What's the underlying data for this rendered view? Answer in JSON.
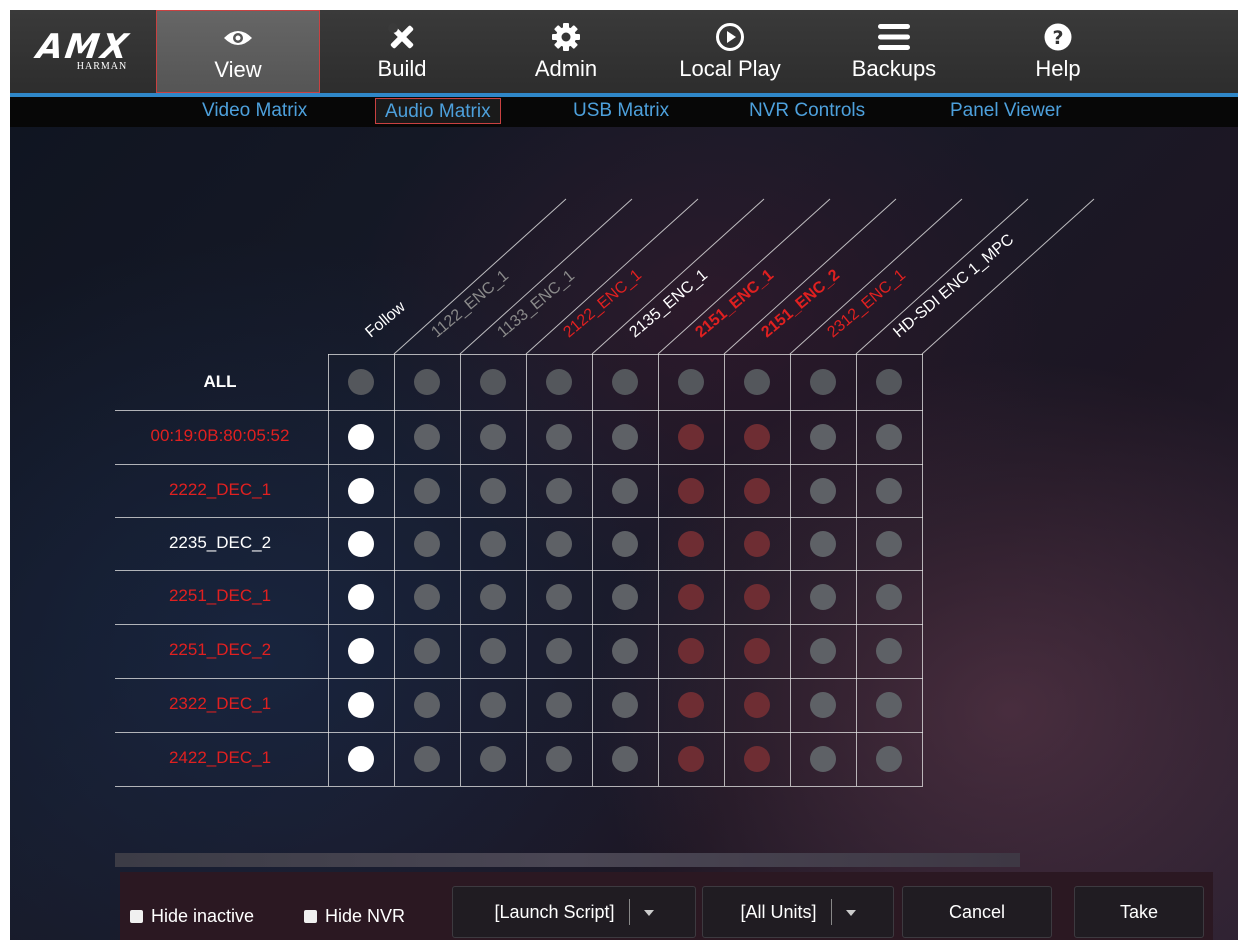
{
  "brand": {
    "logo": "AMX",
    "sub": "HARMAN"
  },
  "nav": [
    {
      "label": "View",
      "icon": "eye-icon",
      "active": true
    },
    {
      "label": "Build",
      "icon": "tools-icon",
      "active": false
    },
    {
      "label": "Admin",
      "icon": "gear-icon",
      "active": false
    },
    {
      "label": "Local Play",
      "icon": "play-icon",
      "active": false
    },
    {
      "label": "Backups",
      "icon": "menu-icon",
      "active": false
    },
    {
      "label": "Help",
      "icon": "help-icon",
      "active": false
    }
  ],
  "subnav": [
    {
      "label": "Video Matrix",
      "active": false
    },
    {
      "label": "Audio Matrix",
      "active": true
    },
    {
      "label": "USB Matrix",
      "active": false
    },
    {
      "label": "NVR Controls",
      "active": false
    },
    {
      "label": "Panel Viewer",
      "active": false
    }
  ],
  "matrix": {
    "columns": [
      {
        "label": "Follow",
        "color": "#ffffff",
        "bold": false
      },
      {
        "label": "1122_ENC_1",
        "color": "#8a8a8a",
        "bold": false
      },
      {
        "label": "1133_ENC_1",
        "color": "#8a8a8a",
        "bold": false
      },
      {
        "label": "2122_ENC_1",
        "color": "#e02020",
        "bold": false
      },
      {
        "label": "2135_ENC_1",
        "color": "#ffffff",
        "bold": false
      },
      {
        "label": "2151_ENC_1",
        "color": "#e02020",
        "bold": true
      },
      {
        "label": "2151_ENC_2",
        "color": "#e02020",
        "bold": true
      },
      {
        "label": "2312_ENC_1",
        "color": "#e02020",
        "bold": false
      },
      {
        "label": "HD-SDI ENC 1_MPC",
        "color": "#ffffff",
        "bold": false
      }
    ],
    "all_label": "ALL",
    "rows": [
      {
        "label": "00:19:0B:80:05:52",
        "color": "#e02020"
      },
      {
        "label": "2222_DEC_1",
        "color": "#e02020"
      },
      {
        "label": "2235_DEC_2",
        "color": "#ffffff"
      },
      {
        "label": "2251_DEC_1",
        "color": "#e02020"
      },
      {
        "label": "2251_DEC_2",
        "color": "#e02020"
      },
      {
        "label": "2322_DEC_1",
        "color": "#e02020"
      },
      {
        "label": "2422_DEC_1",
        "color": "#e02020"
      }
    ],
    "selected_column": "Follow",
    "red_columns": [
      "2151_ENC_1",
      "2151_ENC_2"
    ]
  },
  "footer": {
    "hide_inactive": "Hide inactive",
    "hide_nvr": "Hide NVR",
    "launch_script": "[Launch Script]",
    "all_units": "[All Units]",
    "cancel": "Cancel",
    "take": "Take"
  },
  "colors": {
    "accent": "#2f87c8",
    "link": "#4da0dc",
    "active_border": "#c94141",
    "offline": "#e02020"
  }
}
